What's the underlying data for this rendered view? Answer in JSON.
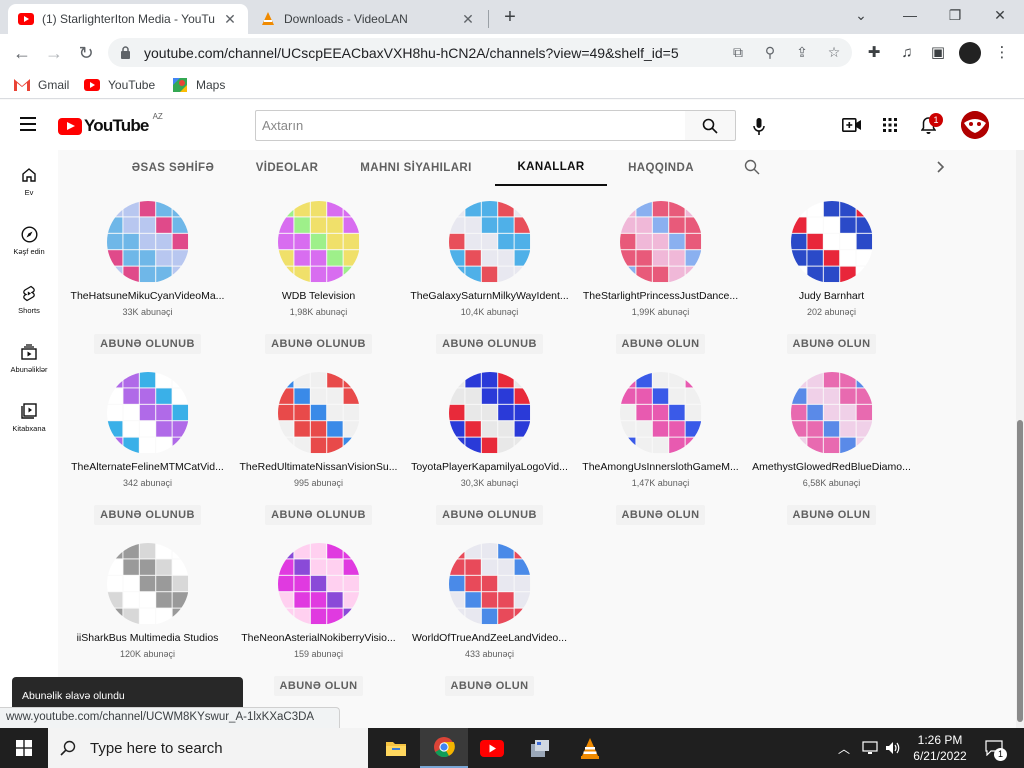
{
  "browser": {
    "tabs": [
      {
        "title": "(1) StarlighterIton Media - YouTu",
        "active": true
      },
      {
        "title": "Downloads - VideoLAN",
        "active": false
      }
    ],
    "url": "youtube.com/channel/UCscpEEACbaxVXH8hu-hCN2A/channels?view=49&shelf_id=5",
    "bookmarks": [
      "Gmail",
      "YouTube",
      "Maps"
    ],
    "window_controls": {
      "minimize": "—",
      "restore": "❐",
      "close": "✕"
    },
    "status_url": "www.youtube.com/channel/UCWM8KYswur_A-1lxKXaC3DA"
  },
  "youtube": {
    "logo_text": "YouTube",
    "country_code": "AZ",
    "search_placeholder": "Axtarın",
    "notification_count": "1",
    "guide": [
      {
        "label": "Ev",
        "icon": "home-icon"
      },
      {
        "label": "Kəşf edin",
        "icon": "compass-icon"
      },
      {
        "label": "Shorts",
        "icon": "shorts-icon"
      },
      {
        "label": "Abunəliklər",
        "icon": "subscriptions-icon"
      },
      {
        "label": "Kitabxana",
        "icon": "library-icon"
      }
    ],
    "channel_tabs": [
      "ƏSAS SƏHİFƏ",
      "VİDEOLAR",
      "MAHNI SİYAHILARI",
      "KANALLAR",
      "HAQQINDA"
    ],
    "active_tab": "KANALLAR",
    "channels": [
      {
        "name": "TheHatsuneMikuCyanVideoMa...",
        "subs": "33K abunəçi",
        "button": "ABUNƏ OLUNUB",
        "colors": [
          "#b8c7f0",
          "#e04a8a",
          "#6fb7e8"
        ]
      },
      {
        "name": "WDB Television",
        "subs": "1,98K abunəçi",
        "button": "ABUNƏ OLUNUB",
        "colors": [
          "#d86df0",
          "#9ef08a",
          "#f0e06a"
        ]
      },
      {
        "name": "TheGalaxySaturnMilkyWayIdent...",
        "subs": "10,4K abunəçi",
        "button": "ABUNƏ OLUNUB",
        "colors": [
          "#4fb0e8",
          "#e84f5a",
          "#e8e8f0"
        ]
      },
      {
        "name": "TheStarlightPrincessJustDance...",
        "subs": "1,99K abunəçi",
        "button": "ABUNƏ OLUN",
        "colors": [
          "#f0b8d8",
          "#8ab0f0",
          "#e85a7a"
        ]
      },
      {
        "name": "Judy Barnhart",
        "subs": "202 abunəçi",
        "button": "ABUNƏ OLUN",
        "colors": [
          "#2a4ac8",
          "#e8263a",
          "#ffffff"
        ]
      },
      {
        "name": "TheAlternateFelineMTMCatVid...",
        "subs": "342 abunəçi",
        "button": "ABUNƏ OLUNUB",
        "colors": [
          "#b06ae8",
          "#3ab0e8",
          "#ffffff"
        ]
      },
      {
        "name": "TheRedUltimateNissanVisionSu...",
        "subs": "995 abunəçi",
        "button": "ABUNƏ OLUNUB",
        "colors": [
          "#e84a4a",
          "#3a8ae8",
          "#f0f0f0"
        ]
      },
      {
        "name": "ToyotaPlayerKapamilyaLogoVid...",
        "subs": "30,3K abunəçi",
        "button": "ABUNƏ OLUNUB",
        "colors": [
          "#2a3ad8",
          "#e82a3a",
          "#e8e8e8"
        ]
      },
      {
        "name": "TheAmongUsInnerslothGameM...",
        "subs": "1,47K abunəçi",
        "button": "ABUNƏ OLUN",
        "colors": [
          "#e85ab0",
          "#3a5ae8",
          "#f0f0f0"
        ]
      },
      {
        "name": "AmethystGlowedRedBlueDiamo...",
        "subs": "6,58K abunəçi",
        "button": "ABUNƏ OLUN",
        "colors": [
          "#e86ab0",
          "#5a8ae8",
          "#f0d0e8"
        ]
      },
      {
        "name": "iiSharkBus Multimedia Studios",
        "subs": "120K abunəçi",
        "button": "",
        "colors": [
          "#9a9a9a",
          "#d8d8d8",
          "#ffffff"
        ]
      },
      {
        "name": "TheNeonAsterialNokiberryVisio...",
        "subs": "159 abunəçi",
        "button": "ABUNƏ OLUN",
        "colors": [
          "#e03ae0",
          "#8a4ad8",
          "#ffd0f0"
        ]
      },
      {
        "name": "WorldOfTrueAndZeeLandVideo...",
        "subs": "433 abunəçi",
        "button": "ABUNƏ OLUN",
        "colors": [
          "#e8e8f0",
          "#4a8ae8",
          "#e84a5a"
        ]
      }
    ],
    "toast": "Abunəlik əlavə olundu"
  },
  "taskbar": {
    "search_placeholder": "Type here to search",
    "time": "1:26 PM",
    "date": "6/21/2022",
    "notification_count": "1"
  }
}
